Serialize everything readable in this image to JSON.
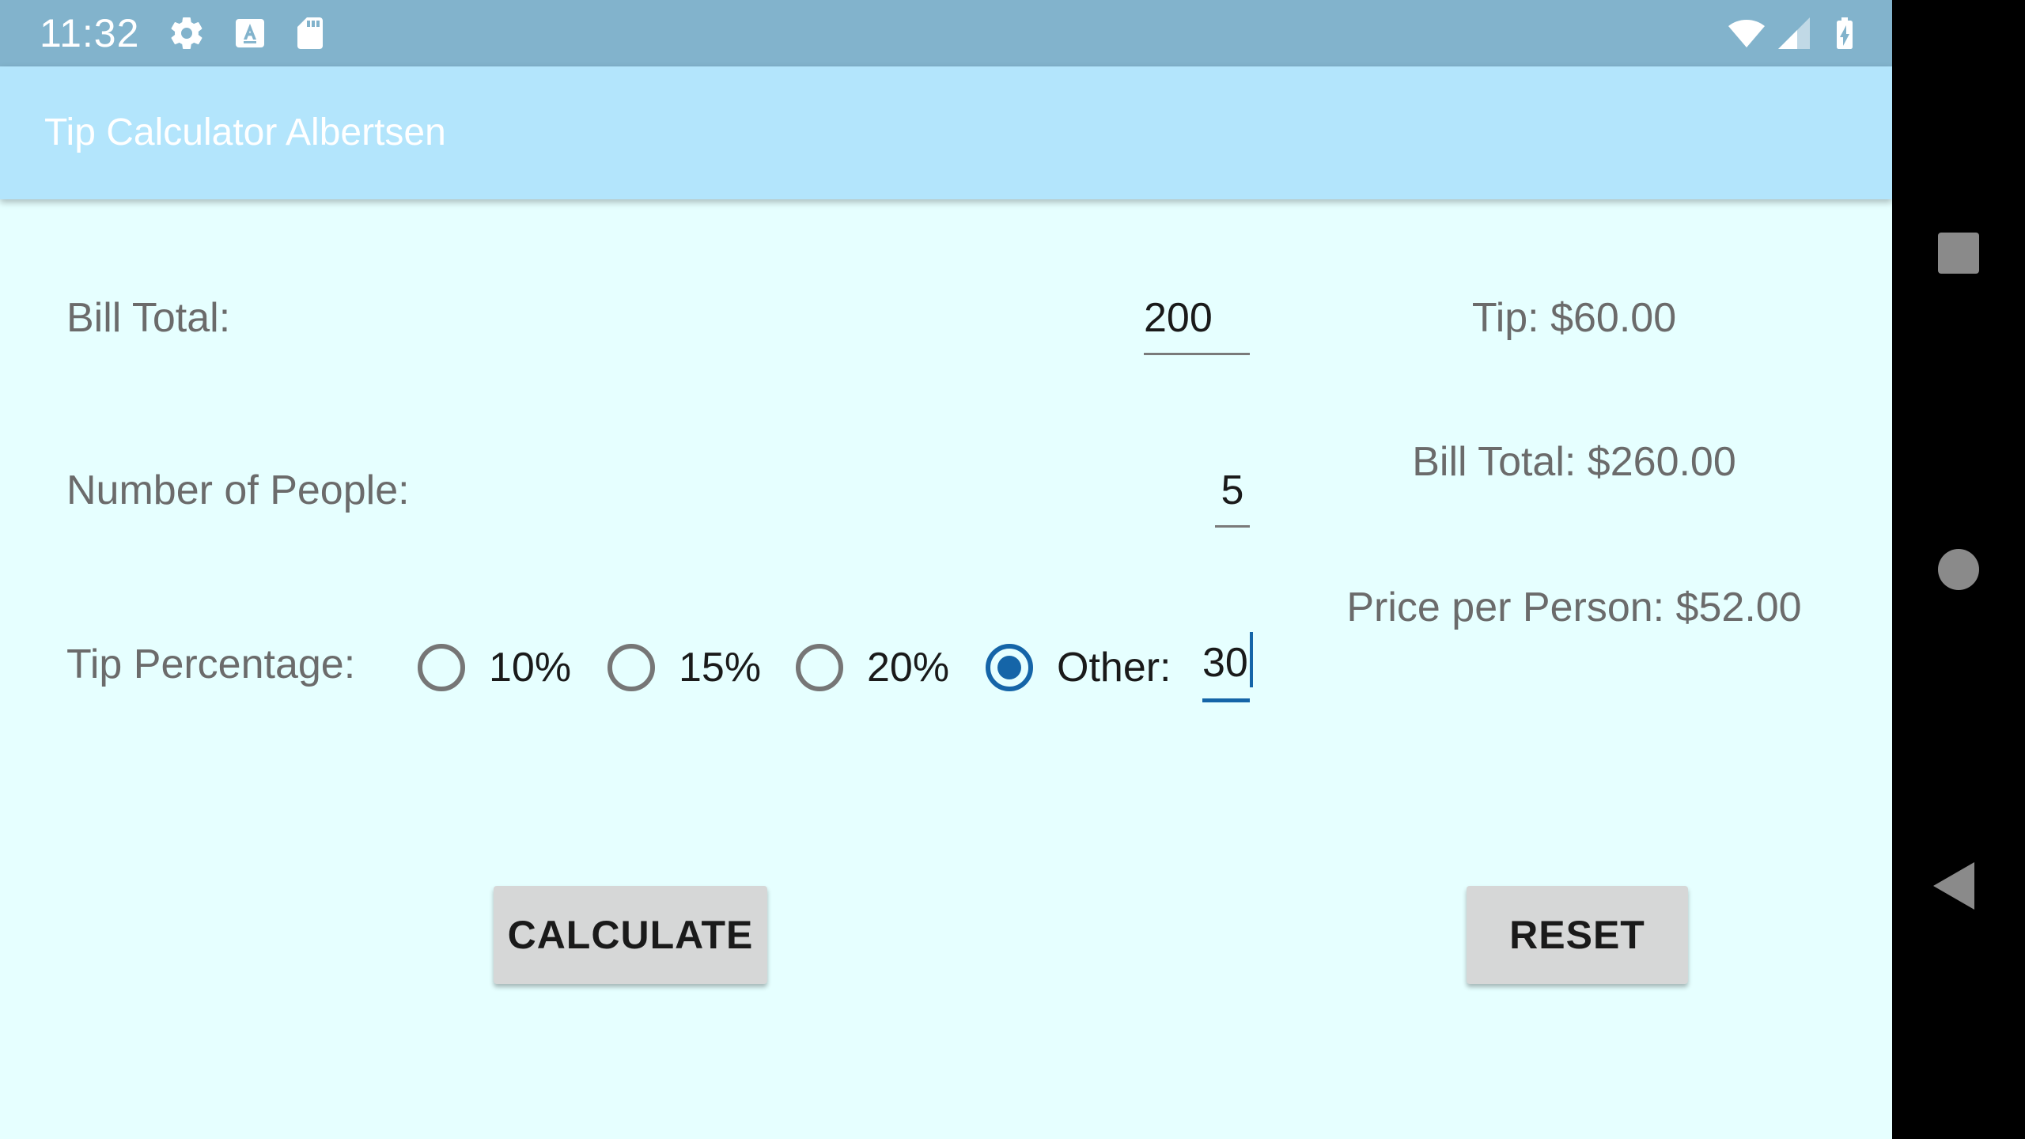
{
  "status_bar": {
    "time": "11:32",
    "icons_left": [
      "settings-icon",
      "a-keyboard-icon",
      "sd-card-icon"
    ],
    "icons_right": [
      "wifi-icon",
      "signal-icon",
      "battery-charging-icon"
    ]
  },
  "app_bar": {
    "title": "Tip Calculator Albertsen"
  },
  "form": {
    "bill_total_label": "Bill Total:",
    "bill_total_value": "200",
    "people_label": "Number of People:",
    "people_value": "5",
    "tip_label": "Tip Percentage:",
    "tip_options": [
      {
        "label": "10%",
        "checked": false
      },
      {
        "label": "15%",
        "checked": false
      },
      {
        "label": "20%",
        "checked": false
      },
      {
        "label": "Other:",
        "checked": true
      }
    ],
    "other_value": "30"
  },
  "results": {
    "tip": "Tip: $60.00",
    "bill_total": "Bill Total: $260.00",
    "price_per_person": "Price per Person: $52.00"
  },
  "buttons": {
    "calculate": "CALCULATE",
    "reset": "RESET"
  },
  "colors": {
    "status_bar": "#82b3cc",
    "app_bar": "#b3e5fc",
    "background": "#e6ffff",
    "accent": "#1565a8"
  },
  "nav_bar": {
    "icons": [
      "recents-square-icon",
      "home-circle-icon",
      "back-triangle-icon"
    ]
  }
}
